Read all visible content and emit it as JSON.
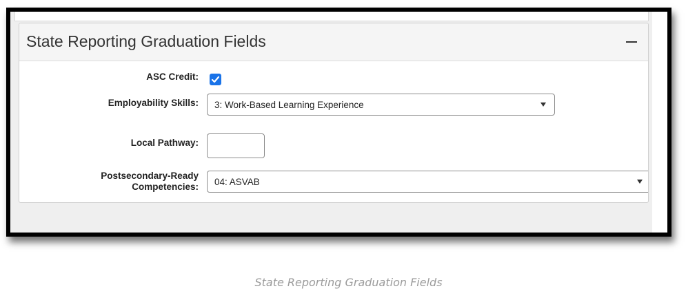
{
  "panel": {
    "title": "State Reporting Graduation Fields",
    "collapse_icon": "minus-icon"
  },
  "fields": {
    "asc_credit": {
      "label": "ASC Credit:",
      "checked": true
    },
    "employability_skills": {
      "label": "Employability Skills:",
      "value": "3: Work-Based Learning Experience"
    },
    "local_pathway": {
      "label": "Local Pathway:",
      "value": ""
    },
    "postsecondary_ready": {
      "label_line1": "Postsecondary-Ready",
      "label_line2": "Competencies:",
      "value": "04: ASVAB"
    }
  },
  "caption": "State Reporting Graduation Fields",
  "colors": {
    "checkbox_accent": "#1a73e8",
    "frame_border": "#000000",
    "caption_text": "#9b9b9b"
  }
}
